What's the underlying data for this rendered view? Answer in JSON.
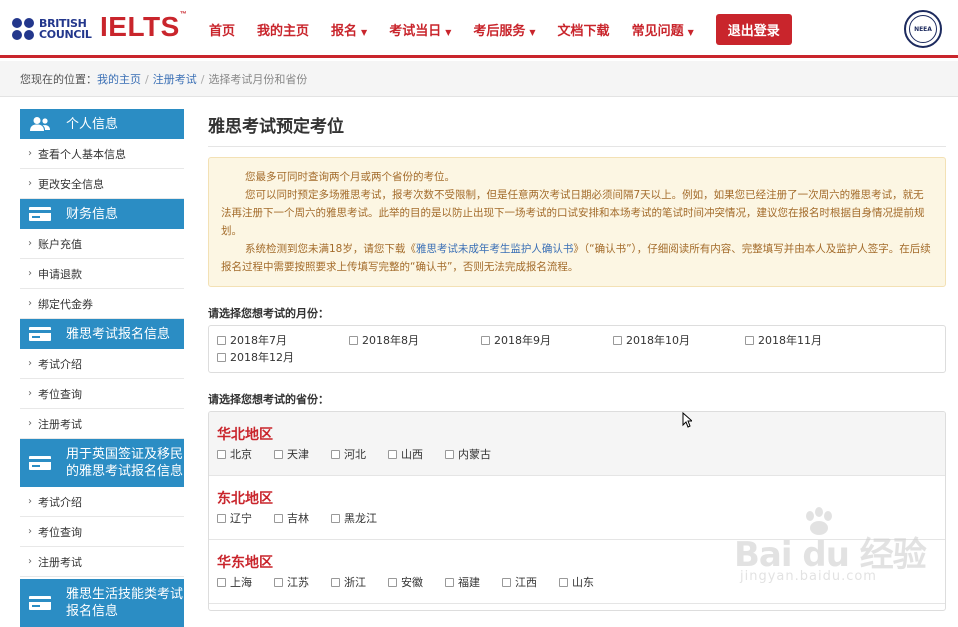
{
  "brand": {
    "bc_line1": "BRITISH",
    "bc_line2": "COUNCIL",
    "ielts": "IELTS",
    "tm": "™",
    "neea": "NEEA",
    "colors": {
      "red": "#c9252c",
      "blue": "#2b8dc4",
      "navy": "#23378c"
    }
  },
  "nav": {
    "items": [
      {
        "label": "首页",
        "caret": false
      },
      {
        "label": "我的主页",
        "caret": false
      },
      {
        "label": "报名",
        "caret": true
      },
      {
        "label": "考试当日",
        "caret": true
      },
      {
        "label": "考后服务",
        "caret": true
      },
      {
        "label": "文档下载",
        "caret": false
      },
      {
        "label": "常见问题",
        "caret": true
      }
    ],
    "logout": "退出登录"
  },
  "breadcrumb": {
    "prefix": "您现在的位置：",
    "items": [
      "我的主页",
      "注册考试"
    ],
    "current": "选择考试月份和省份"
  },
  "sidebar": {
    "sections": [
      {
        "title": "个人信息",
        "icon": "user-icon",
        "items": [
          "查看个人基本信息",
          "更改安全信息"
        ]
      },
      {
        "title": "财务信息",
        "icon": "card-icon",
        "items": [
          "账户充值",
          "申请退款",
          "绑定代金券"
        ]
      },
      {
        "title": "雅思考试报名信息",
        "icon": "card-icon",
        "items": [
          "考试介绍",
          "考位查询",
          "注册考试"
        ]
      },
      {
        "title": "用于英国签证及移民的雅思考试报名信息",
        "icon": "card-icon",
        "items": [
          "考试介绍",
          "考位查询",
          "注册考试"
        ]
      },
      {
        "title": "雅思生活技能类考试报名信息",
        "icon": "card-icon",
        "items": []
      }
    ]
  },
  "main": {
    "title": "雅思考试预定考位",
    "notice": {
      "p1": "您最多可同时查询两个月或两个省份的考位。",
      "p2": "您可以同时预定多场雅思考试，报考次数不受限制，但是任意两次考试日期必须间隔7天以上。例如，如果您已经注册了一次周六的雅思考试，就无法再注册下一个周六的雅思考试。此举的目的是以防止出现下一场考试的口试安排和本场考试的笔试时间冲突情况，建议您在报名时根据自身情况提前规划。",
      "p3_before": "系统检测到您未满18岁，请您下载《",
      "p3_link": "雅思考试未成年考生监护人确认书",
      "p3_after": "》（“确认书”），仔细阅读所有内容、完整填写并由本人及监护人签字。在后续报名过程中需要按照要求上传填写完整的“确认书”，否则无法完成报名流程。"
    },
    "month_label": "请选择您想考试的月份：",
    "months": [
      "2018年7月",
      "2018年8月",
      "2018年9月",
      "2018年10月",
      "2018年11月",
      "2018年12月"
    ],
    "province_label": "请选择您想考试的省份：",
    "regions": [
      {
        "name": "华北地区",
        "provinces": [
          "北京",
          "天津",
          "河北",
          "山西",
          "内蒙古"
        ]
      },
      {
        "name": "东北地区",
        "provinces": [
          "辽宁",
          "吉林",
          "黑龙江"
        ]
      },
      {
        "name": "华东地区",
        "provinces": [
          "上海",
          "江苏",
          "浙江",
          "安徽",
          "福建",
          "江西",
          "山东"
        ]
      }
    ]
  },
  "watermark": {
    "main": "Bai du 经验",
    "sub": "jingyan.baidu.com"
  }
}
